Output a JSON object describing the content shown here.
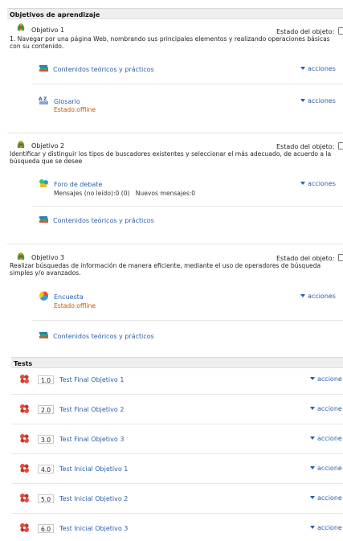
{
  "sections": {
    "objectives_title": "Objetivos de aprendizaje",
    "tests_title": "Tests"
  },
  "objectives": [
    {
      "title": "Objetivo 1",
      "state_label": "Estado del objeto:",
      "description": "1. Navegar por una página Web, nombrando sus principales elementos y realizando operaciones básicas con su contenido."
    },
    {
      "title": "Objetivo 2",
      "state_label": "Estado del objeto:",
      "description": "Identificar y distinguir los tipos de buscadores existentes y seleccionar el más adecuado, de acuerdo a la búsqueda que se desee"
    },
    {
      "title": "Objetivo 3",
      "state_label": "Estado del objeto:",
      "description": "Realizar búsquedas de información de manera eficiente, mediante el uso de operadores de búsqueda simples y/o avanzados."
    }
  ],
  "resources": {
    "contenidos": "Contenidos teóricos y prácticos",
    "glosario": "Glosario",
    "foro": "Foro de debate",
    "foro_stats": "Mensajes (no leído):0 (0)   Nuevos mensajes:0",
    "encuesta": "Encuesta",
    "offline": "Estado:offline",
    "acciones": "acciones",
    "acciones_cut": "accione"
  },
  "tests": [
    {
      "num": "1.0",
      "name": "Test Final Objetivo 1"
    },
    {
      "num": "2.0",
      "name": "Test Final Objetivo 2"
    },
    {
      "num": "3.0",
      "name": "Test Final Objetivo 3"
    },
    {
      "num": "4.0",
      "name": "Test Inicial Objetivo 1"
    },
    {
      "num": "5.0",
      "name": "Test Inicial Objetivo 2"
    },
    {
      "num": "6.0",
      "name": "Test Inicial Objetivo 3"
    }
  ],
  "colors": {
    "link": "#2b5ea8",
    "offline": "#d35400",
    "header_bg": "#eceef0"
  }
}
